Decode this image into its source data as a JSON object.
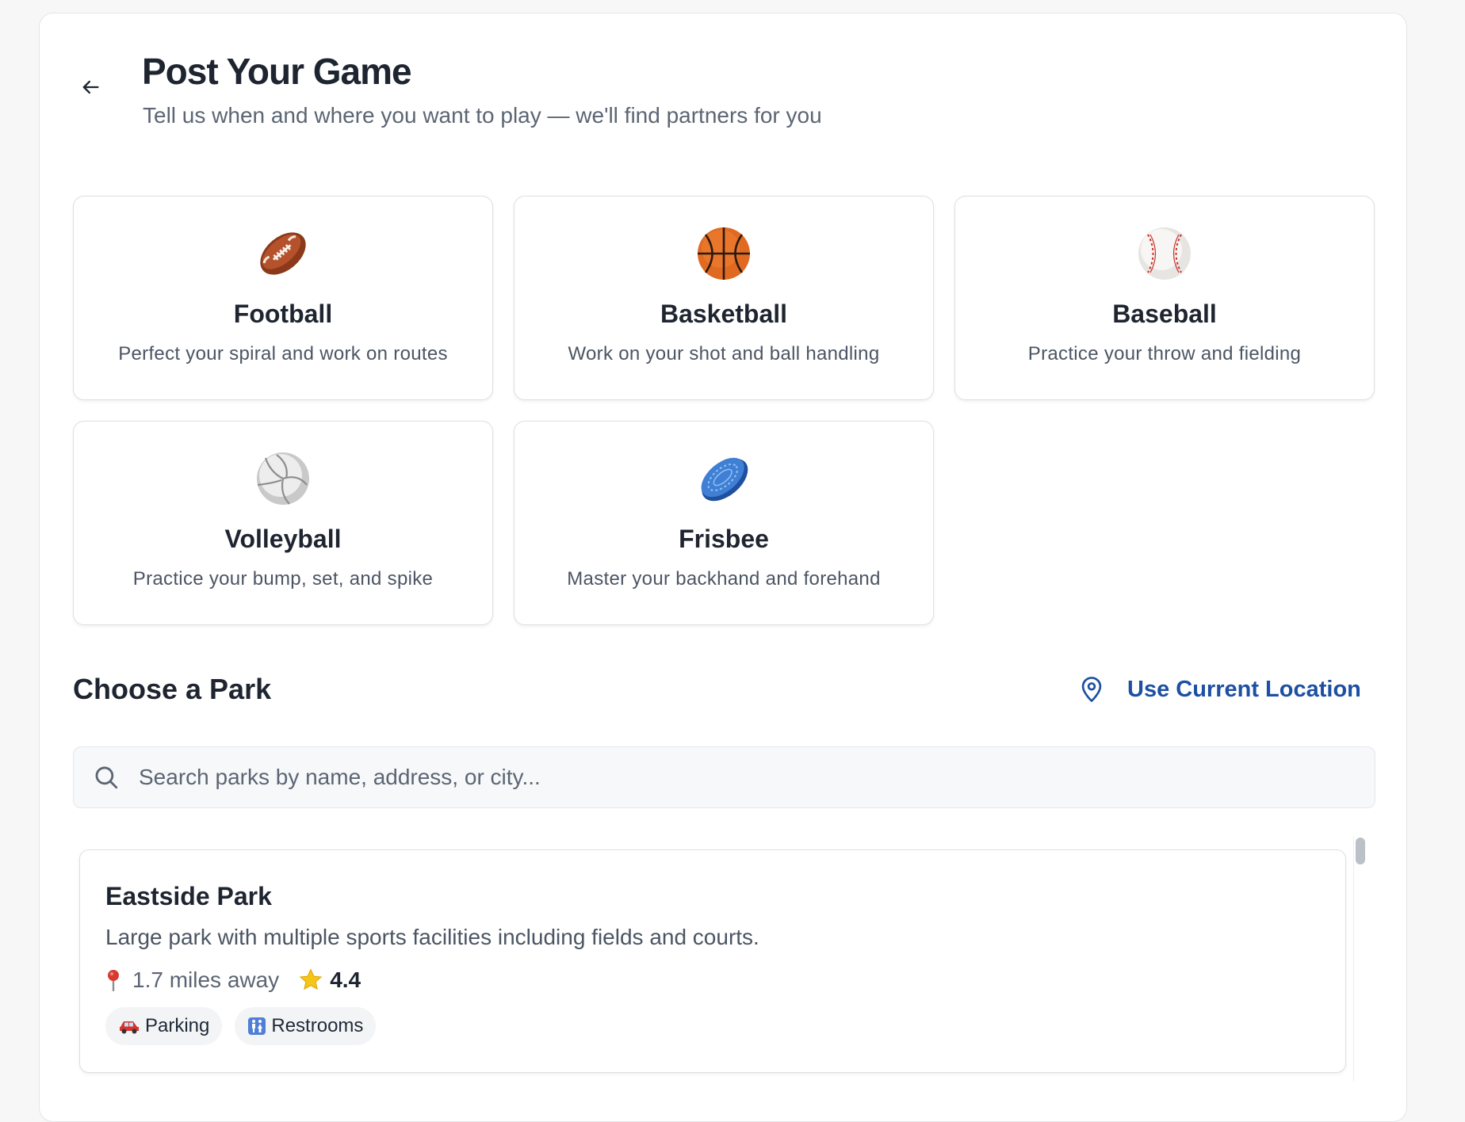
{
  "header": {
    "title": "Post Your Game",
    "subtitle": "Tell us when and where you want to play — we'll find partners for you",
    "back_icon": "arrow-left-icon"
  },
  "sports": [
    {
      "name": "Football",
      "description": "Perfect your spiral and work on routes",
      "icon": "football-icon"
    },
    {
      "name": "Basketball",
      "description": "Work on your shot and ball handling",
      "icon": "basketball-icon"
    },
    {
      "name": "Baseball",
      "description": "Practice your throw and fielding",
      "icon": "baseball-icon"
    },
    {
      "name": "Volleyball",
      "description": "Practice your bump, set, and spike",
      "icon": "volleyball-icon"
    },
    {
      "name": "Frisbee",
      "description": "Master your backhand and forehand",
      "icon": "frisbee-icon"
    }
  ],
  "park_section": {
    "title": "Choose a Park",
    "use_location_label": "Use Current Location",
    "location_icon": "map-pin-icon",
    "accent_color": "#1d4fa3"
  },
  "search": {
    "placeholder": "Search parks by name, address, or city...",
    "value": ""
  },
  "parks": [
    {
      "name": "Eastside Park",
      "description": "Large park with multiple sports facilities including fields and courts.",
      "distance": "1.7 miles away",
      "rating": "4.4",
      "amenities": [
        {
          "label": "Parking",
          "icon": "car-icon"
        },
        {
          "label": "Restrooms",
          "icon": "restroom-icon"
        }
      ]
    }
  ]
}
